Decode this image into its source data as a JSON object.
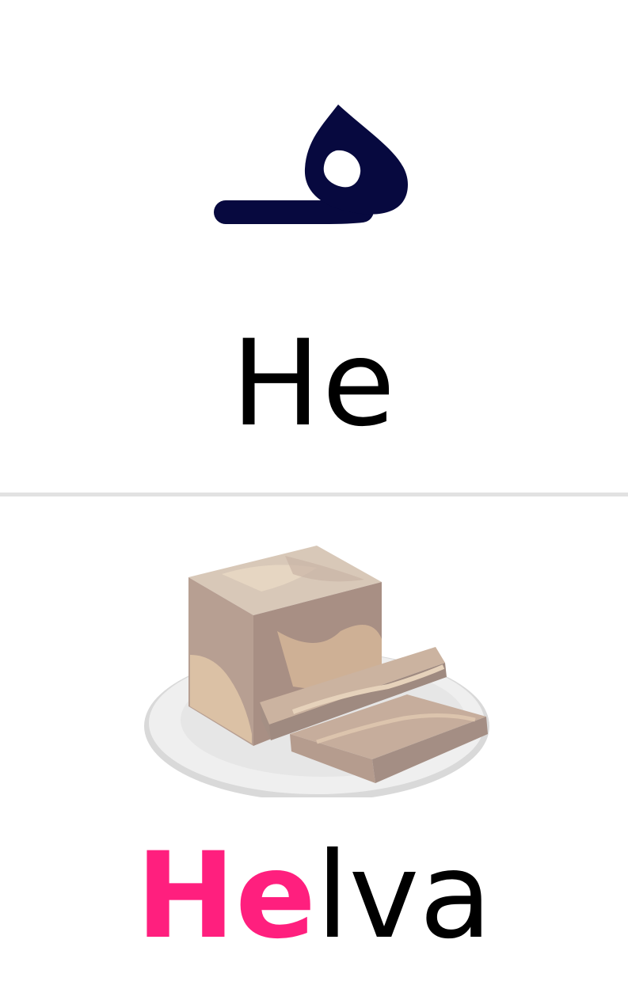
{
  "letter": {
    "glyph_icon": "arabic-heh-medial-icon",
    "glyph_color": "#07093f",
    "name": "He"
  },
  "divider_color": "#e2e2e2",
  "word": {
    "highlight": "He",
    "rest": "lva",
    "highlight_color": "#ff1f7e",
    "picture_icon": "halva-on-plate-illustration"
  }
}
